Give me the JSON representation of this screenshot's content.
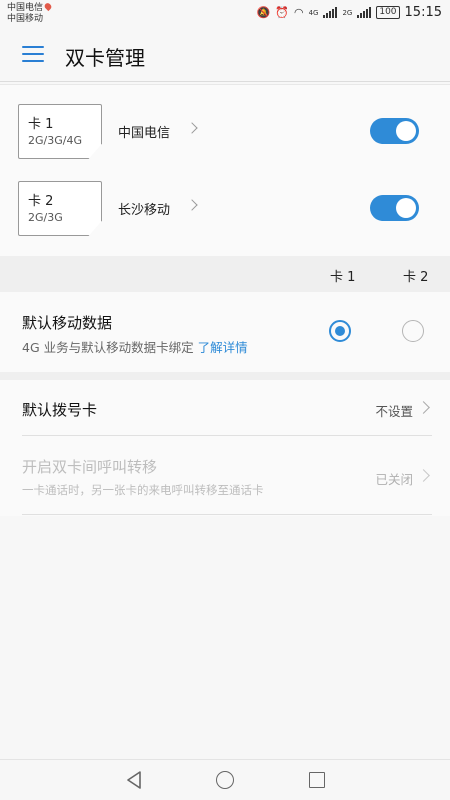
{
  "status_bar": {
    "carrier_1": "中国电信",
    "carrier_2": "中国移动",
    "network_1": "4G",
    "network_2": "2G",
    "battery": "100",
    "time": "15:15"
  },
  "app_bar": {
    "title": "双卡管理",
    "menu_icon": "hamburger-icon"
  },
  "sims": [
    {
      "name": "卡 1",
      "networks": "2G/3G/4G",
      "carrier": "中国电信",
      "enabled": true
    },
    {
      "name": "卡 2",
      "networks": "2G/3G",
      "carrier": "长沙移动",
      "enabled": true
    }
  ],
  "columns": {
    "sim1": "卡 1",
    "sim2": "卡 2"
  },
  "default_data": {
    "title": "默认移动数据",
    "subtitle": "4G 业务与默认移动数据卡绑定",
    "link": "了解详情",
    "selected": "sim1"
  },
  "default_dial": {
    "title": "默认拨号卡",
    "value": "不设置"
  },
  "call_forwarding": {
    "title": "开启双卡间呼叫转移",
    "subtitle": "一卡通话时，另一张卡的来电呼叫转移至通话卡",
    "value": "已关闭",
    "enabled": false
  },
  "colors": {
    "accent": "#2f8bd7",
    "background": "#f7f7f7",
    "disabled_text": "#bdbdbd"
  },
  "navigation": [
    "back-icon",
    "home-icon",
    "recent-apps-icon"
  ]
}
